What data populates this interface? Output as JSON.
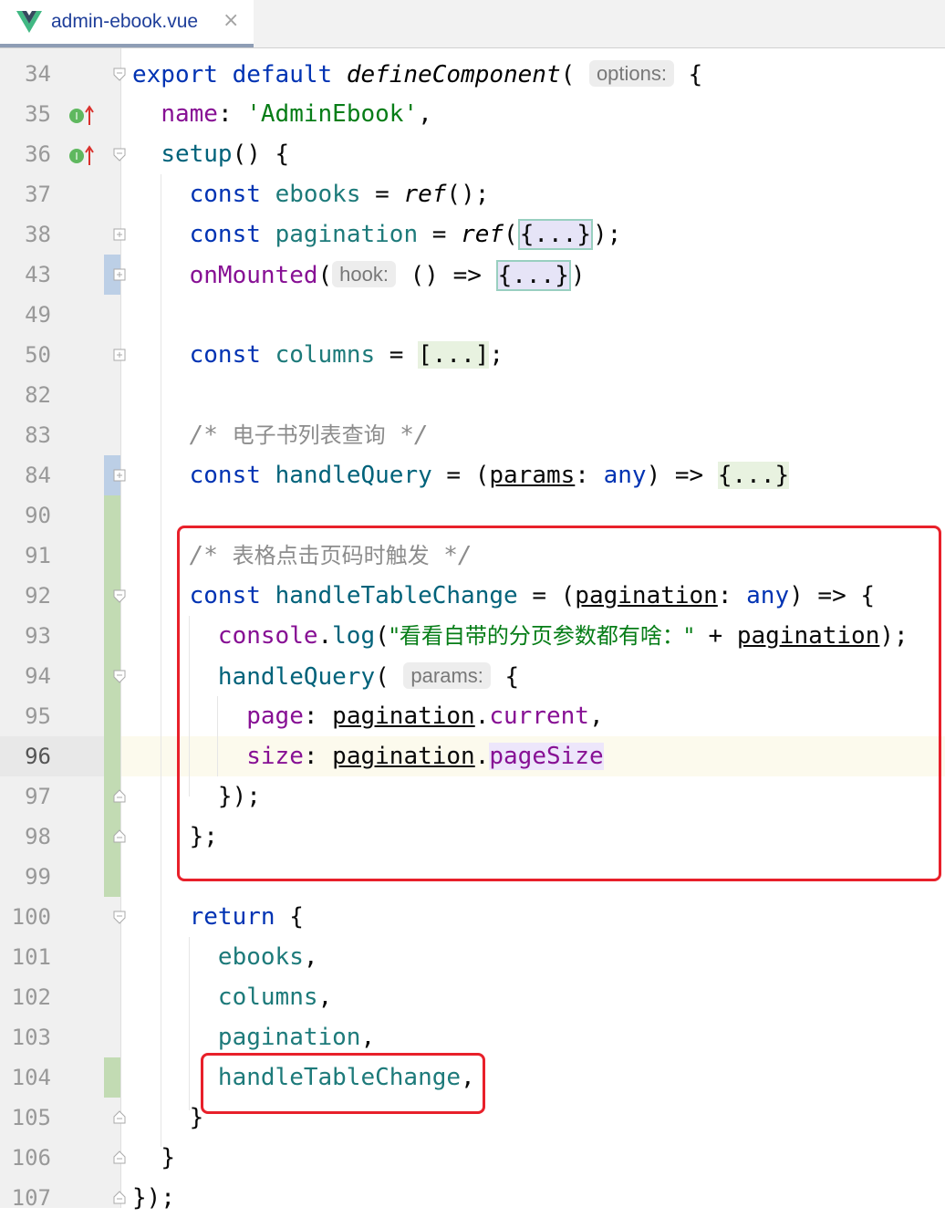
{
  "tab": {
    "label": "admin-ebook.vue",
    "close": "×",
    "icon": "vue-logo-icon"
  },
  "colors": {
    "keyword": "#0033b3",
    "string": "#067d17",
    "property": "#871094",
    "comment": "#8c8c8c",
    "change_marker": "#c2dbb3",
    "modified_marker": "#bccfe6",
    "highlight_box": "#e8202a"
  },
  "editor": {
    "current_line": "96",
    "lines": [
      {
        "num": "34"
      },
      {
        "num": "35"
      },
      {
        "num": "36"
      },
      {
        "num": "37"
      },
      {
        "num": "38"
      },
      {
        "num": "43"
      },
      {
        "num": "49"
      },
      {
        "num": "50"
      },
      {
        "num": "82"
      },
      {
        "num": "83"
      },
      {
        "num": "84"
      },
      {
        "num": "90"
      },
      {
        "num": "91"
      },
      {
        "num": "92"
      },
      {
        "num": "93"
      },
      {
        "num": "94"
      },
      {
        "num": "95"
      },
      {
        "num": "96"
      },
      {
        "num": "97"
      },
      {
        "num": "98"
      },
      {
        "num": "99"
      },
      {
        "num": "100"
      },
      {
        "num": "101"
      },
      {
        "num": "102"
      },
      {
        "num": "103"
      },
      {
        "num": "104"
      },
      {
        "num": "105"
      },
      {
        "num": "106"
      },
      {
        "num": "107"
      }
    ],
    "hints": {
      "options": "options:",
      "hook": "hook:",
      "params": "params:"
    },
    "tokens": {
      "l34": {
        "export": "export",
        "default": "default",
        "define": "defineComponent",
        "open": "(",
        "brace": " {"
      },
      "l35": {
        "name": "name",
        "colon": ": ",
        "value": "'AdminEbook'",
        "comma": ","
      },
      "l36": {
        "setup": "setup",
        "rest": "() {"
      },
      "l37": {
        "const": "const",
        "ebooks": "ebooks",
        "eq": " = ",
        "ref": "ref",
        "rest": "();"
      },
      "l38": {
        "const": "const",
        "pagination": "pagination",
        "eq": " = ",
        "ref": "ref",
        "open": "(",
        "fold": "{...}",
        "close": ");"
      },
      "l43": {
        "onMounted": "onMounted",
        "open": "(",
        "arrow": " () => ",
        "fold": "{...}",
        "close": ")"
      },
      "l50": {
        "const": "const",
        "columns": "columns",
        "eq": " = ",
        "fold": "[...]",
        "close": ";"
      },
      "l83": {
        "open": "/* ",
        "text": "电子书列表查询",
        "close": " */"
      },
      "l84": {
        "const": "const",
        "name": "handleQuery",
        "eq": " = (",
        "param": "params",
        "colon": ": ",
        "any": "any",
        "arrow": ") => ",
        "fold": "{...}"
      },
      "l91": {
        "open": "/* ",
        "text": "表格点击页码时触发",
        "close": " */"
      },
      "l92": {
        "const": "const",
        "name": "handleTableChange",
        "eq": " = (",
        "param": "pagination",
        "colon": ": ",
        "any": "any",
        "arrow": ") => {"
      },
      "l93": {
        "console": "console",
        "dot": ".",
        "log": "log",
        "open": "(",
        "str": "\"看看自带的分页参数都有啥：\"",
        "plus": " + ",
        "param": "pagination",
        "close": ");"
      },
      "l94": {
        "name": "handleQuery",
        "open": "(",
        "brace": " {"
      },
      "l95": {
        "key": "page",
        "colon": ": ",
        "param": "pagination",
        "dot": ".",
        "prop": "current",
        "comma": ","
      },
      "l96": {
        "key": "size",
        "colon": ": ",
        "param": "pagination",
        "dot": ".",
        "prop": "pageSize"
      },
      "l97": {
        "text": "});"
      },
      "l98": {
        "text": "};"
      },
      "l100": {
        "return": "return",
        "brace": " {"
      },
      "l101": {
        "name": "ebooks",
        "comma": ","
      },
      "l102": {
        "name": "columns",
        "comma": ","
      },
      "l103": {
        "name": "pagination",
        "comma": ","
      },
      "l104": {
        "name": "handleTableChange",
        "comma": ","
      },
      "l105": {
        "text": "}"
      },
      "l106": {
        "text": "}"
      },
      "l107": {
        "text": "});"
      }
    }
  }
}
